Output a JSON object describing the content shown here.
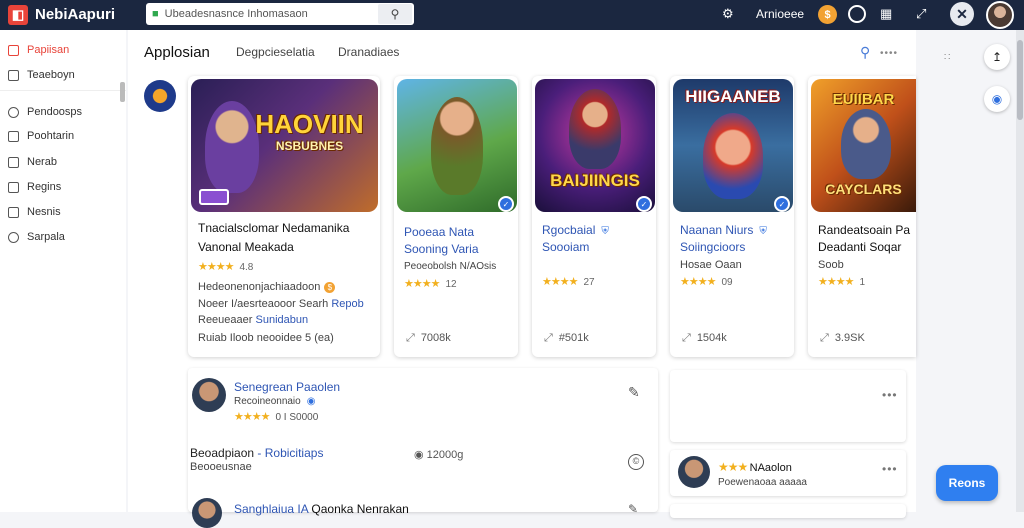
{
  "app": {
    "name": "NebiAapuri"
  },
  "search": {
    "value": "Ubeadesnasnce Inhomasaon"
  },
  "topbar": {
    "username": "Arnioeee",
    "coin_symbol": "$"
  },
  "sidebar": {
    "items": [
      {
        "label": "Papiisan",
        "active": true
      },
      {
        "label": "Teaeboyn"
      },
      {
        "label": "Pendoosps"
      },
      {
        "label": "Poohtarin"
      },
      {
        "label": "Nerab"
      },
      {
        "label": "Regins"
      },
      {
        "label": "Nesnis"
      },
      {
        "label": "Sarpala"
      }
    ]
  },
  "main": {
    "title": "Applosian",
    "tabs": [
      "Degpcieselatia",
      "Dranadiaes"
    ]
  },
  "cards": [
    {
      "art_title": "HAOVIIN",
      "art_subtitle": "NSBUBNES",
      "line1": "Tnacialsclomar Nedamanika",
      "line2": "Vanonal Meakada",
      "rating": "4.8",
      "stars": "★★★★",
      "desc1": "Hedeonenonjachiaadoon",
      "desc2": "Noeer I/aesrteaooor Searh",
      "desc2_link": "Repob",
      "desc3": "Reeueaaer",
      "desc3_link": "Sunidabun",
      "desc4": "Ruiab Iloob neooidee 5 (ea)",
      "downloads": ""
    },
    {
      "art_title": "",
      "line1": "Pooeaa Nata",
      "line2": "Sooning Varia",
      "desc1": "Peoeobolsh N/AOsis",
      "stars": "★★★★",
      "rating": "12",
      "downloads": "7008k"
    },
    {
      "art_title": "BAIJIINGIS",
      "line1": "Rgocbaial",
      "line2": "Soooiam",
      "stars": "★★★★",
      "rating": "27",
      "downloads": "#501k"
    },
    {
      "art_title": "HIIGAANEB",
      "line1": "Naanan Niurs",
      "line2": "Soiingcioors",
      "desc1": "Hosae Oaan",
      "stars": "★★★★",
      "rating": "09",
      "downloads": "1504k"
    },
    {
      "art_title": "EUIIBAR",
      "art_subtitle": "CAYCLARS",
      "line1": "Randeatsoain Pa",
      "line2": "Deadanti Soqar",
      "desc1": "Soob",
      "stars": "★★★★",
      "rating": "1",
      "downloads": "3.9SK"
    }
  ],
  "reviews": [
    {
      "name": "Senegrean Paaolen",
      "sub": "Recoineonnaio",
      "stars": "★★★★",
      "val": "0  I  S0000"
    }
  ],
  "detail": {
    "title": "Beoadpiaon",
    "link": "Robicitiaps",
    "sub": "Beooeusnae",
    "count": "12000g"
  },
  "review2": {
    "name": "Sanghlaiua IA",
    "name_rest": "Qaonka Nenrakan"
  },
  "right_review": {
    "name": "NAaolon",
    "stars": "★★★",
    "sub": "Poewenaoaa aaaaa"
  },
  "fab": {
    "label": "Reons"
  }
}
